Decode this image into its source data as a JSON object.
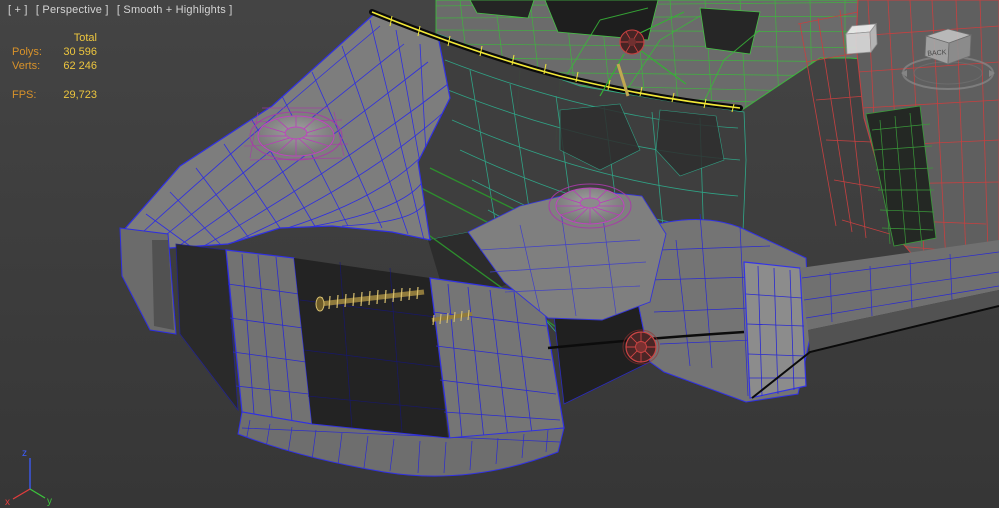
{
  "viewport": {
    "label": {
      "general_menu": "[ + ]",
      "pov_menu": "[ Perspective ]",
      "shading_menu": "[ Smooth + Highlights ]"
    },
    "statistics": {
      "total_label": "Total",
      "polys_label": "Polys:",
      "polys_value": "30 596",
      "verts_label": "Verts:",
      "verts_value": "62 246",
      "fps_label": "FPS:",
      "fps_value": "29,723"
    },
    "viewcube": {
      "visible_face_label": "BACK"
    },
    "axis_tripod": {
      "x_label": "x",
      "y_label": "y",
      "z_label": "z"
    }
  },
  "colors": {
    "background_top": "#444444",
    "background_bottom": "#363636",
    "wire_blue": "#2e2ee0",
    "wire_green": "#3cbb3c",
    "wire_red": "#c64040",
    "wire_teal": "#2fae8e",
    "wire_magenta": "#b83cb8",
    "selection_yellow": "#f2e838",
    "stats_label_color": "#d8922a",
    "stats_value_color": "#edc63e"
  }
}
